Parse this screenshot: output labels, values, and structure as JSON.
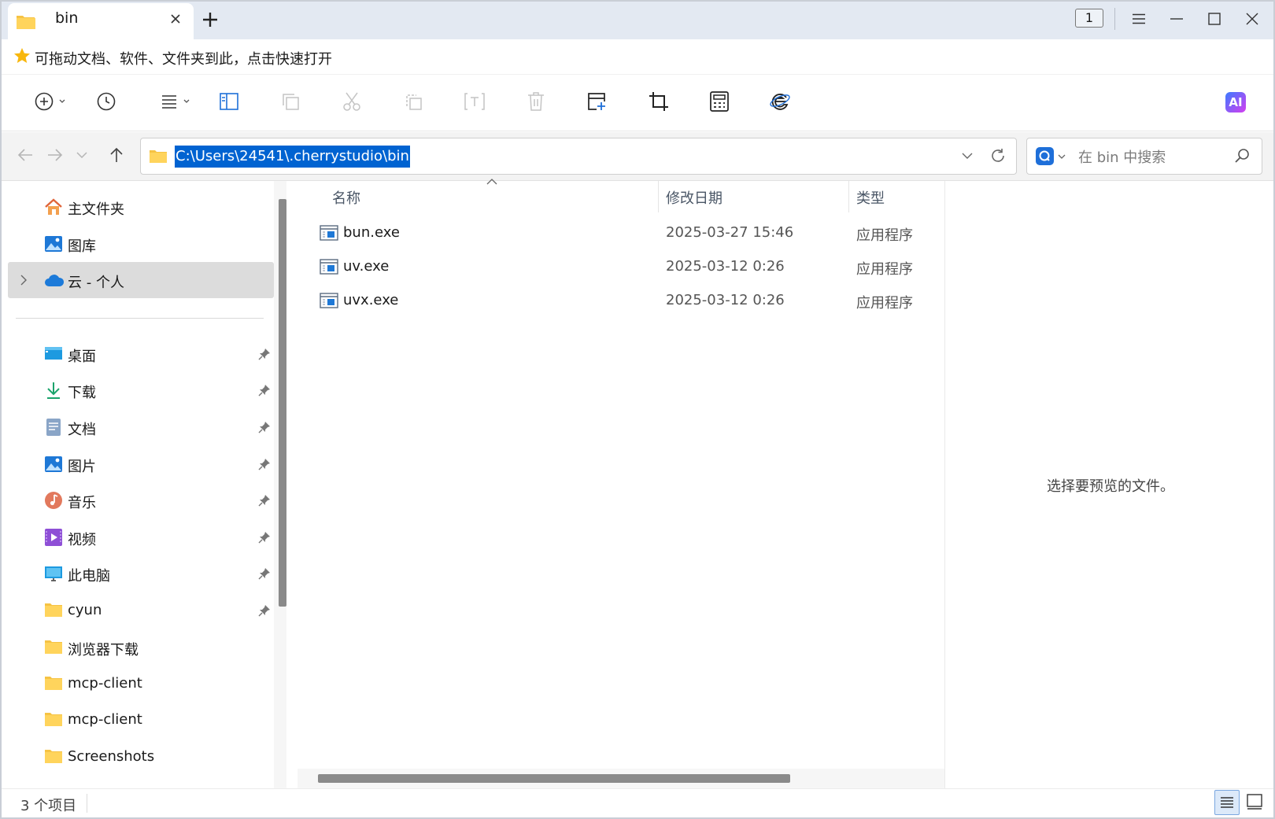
{
  "window": {
    "tab_title": "bin",
    "instance_count": "1",
    "favorites_hint": "可拖动文档、软件、文件夹到此，点击快速打开"
  },
  "address": {
    "path": "C:\\Users\\24541\\.cherrystudio\\bin",
    "search_placeholder": "在 bin 中搜索"
  },
  "nav": {
    "top": [
      {
        "label": "主文件夹",
        "icon": "home-icon"
      },
      {
        "label": "图库",
        "icon": "gallery-icon"
      },
      {
        "label": "云 - 个人",
        "icon": "cloud-icon",
        "selected": true
      }
    ],
    "pinned": [
      {
        "label": "桌面",
        "icon": "desktop-icon",
        "pinned": true
      },
      {
        "label": "下载",
        "icon": "download-icon",
        "pinned": true
      },
      {
        "label": "文档",
        "icon": "document-icon",
        "pinned": true
      },
      {
        "label": "图片",
        "icon": "pictures-icon",
        "pinned": true
      },
      {
        "label": "音乐",
        "icon": "music-icon",
        "pinned": true
      },
      {
        "label": "视频",
        "icon": "video-icon",
        "pinned": true
      },
      {
        "label": "此电脑",
        "icon": "computer-icon",
        "pinned": true
      },
      {
        "label": "cyun",
        "icon": "folder-icon",
        "pinned": true
      },
      {
        "label": "浏览器下载",
        "icon": "folder-icon",
        "pinned": false
      },
      {
        "label": "mcp-client",
        "icon": "folder-icon",
        "pinned": false
      },
      {
        "label": "mcp-client",
        "icon": "folder-icon",
        "pinned": false
      },
      {
        "label": "Screenshots",
        "icon": "folder-icon",
        "pinned": false
      }
    ]
  },
  "list": {
    "columns": {
      "name": "名称",
      "modified": "修改日期",
      "type": "类型"
    },
    "files": [
      {
        "name": "bun.exe",
        "modified": "2025-03-27 15:46",
        "type": "应用程序"
      },
      {
        "name": "uv.exe",
        "modified": "2025-03-12 0:26",
        "type": "应用程序"
      },
      {
        "name": "uvx.exe",
        "modified": "2025-03-12 0:26",
        "type": "应用程序"
      }
    ]
  },
  "preview": {
    "empty_text": "选择要预览的文件。"
  },
  "status": {
    "item_count": "3 个项目"
  },
  "toolbar": {
    "ai_label": "AI"
  },
  "colors": {
    "accent": "#0063d1",
    "titlebar": "#e3e9f2",
    "folder": "#f6c344",
    "ai_gradient": [
      "#3b7bff",
      "#d63df0"
    ]
  }
}
